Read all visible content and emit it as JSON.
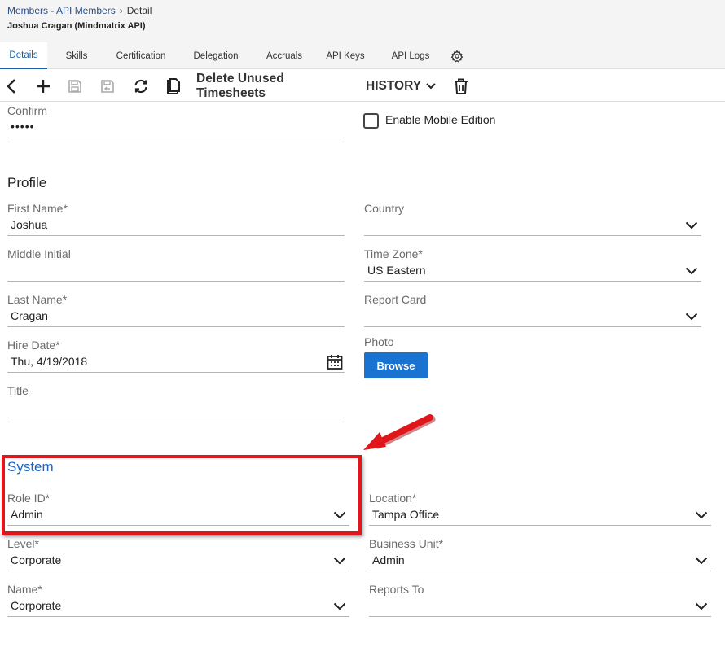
{
  "breadcrumb": {
    "parent": "Members - API Members",
    "separator": "›",
    "current": "Detail"
  },
  "page_title": "Joshua Cragan (Mindmatrix API)",
  "tabs": [
    {
      "label": "Details",
      "active": true
    },
    {
      "label": "Skills"
    },
    {
      "label": "Certification"
    },
    {
      "label": "Delegation"
    },
    {
      "label": "Accruals"
    },
    {
      "label": "API Keys"
    },
    {
      "label": "API Logs"
    }
  ],
  "toolbar": {
    "delete_unused_label": "Delete Unused Timesheets",
    "history_label": "HISTORY",
    "icons": [
      "back-icon",
      "add-icon",
      "save-icon",
      "save-close-icon",
      "refresh-icon",
      "copy-icon",
      "chevron-down-icon",
      "trash-icon"
    ]
  },
  "account": {
    "confirm_label": "Confirm",
    "confirm_value": "•••••",
    "mobile_label": "Enable Mobile Edition",
    "mobile_checked": false
  },
  "profile": {
    "heading": "Profile",
    "first_name": {
      "label": "First Name*",
      "value": "Joshua"
    },
    "middle_initial": {
      "label": "Middle Initial",
      "value": ""
    },
    "last_name": {
      "label": "Last Name*",
      "value": "Cragan"
    },
    "hire_date": {
      "label": "Hire Date*",
      "value": "Thu, 4/19/2018"
    },
    "title": {
      "label": "Title",
      "value": ""
    },
    "country": {
      "label": "Country",
      "value": ""
    },
    "time_zone": {
      "label": "Time Zone*",
      "value": "US Eastern"
    },
    "report_card": {
      "label": "Report Card",
      "value": ""
    },
    "photo": {
      "label": "Photo",
      "browse": "Browse"
    }
  },
  "system": {
    "heading": "System",
    "role_id": {
      "label": "Role ID*",
      "value": "Admin"
    },
    "level": {
      "label": "Level*",
      "value": "Corporate"
    },
    "name": {
      "label": "Name*",
      "value": "Corporate"
    },
    "location": {
      "label": "Location*",
      "value": "Tampa Office"
    },
    "business_unit": {
      "label": "Business Unit*",
      "value": "Admin"
    },
    "reports_to": {
      "label": "Reports To",
      "value": ""
    }
  },
  "colors": {
    "accent": "#1a73d1",
    "heading_blue": "#1a63c4",
    "highlight": "#e0161b"
  }
}
